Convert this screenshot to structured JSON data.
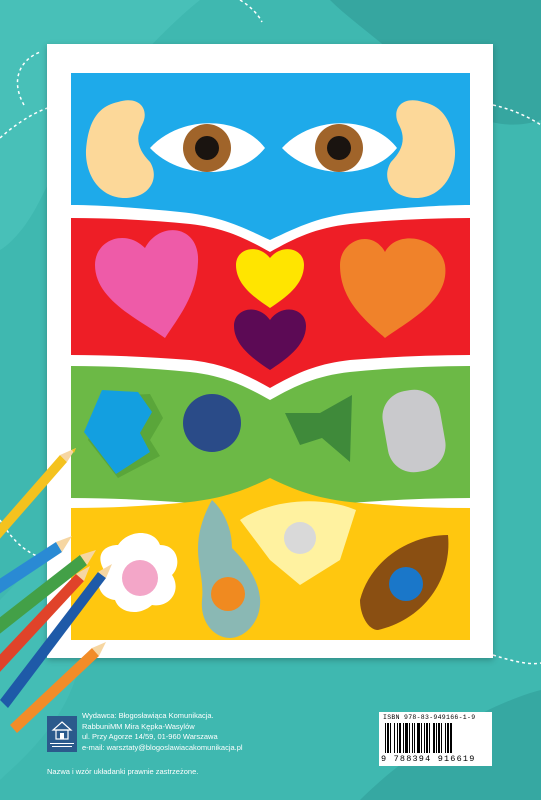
{
  "colors": {
    "background": "#3fb8b0",
    "band_blue": "#1eaaea",
    "band_red": "#ee1e26",
    "band_green": "#6cb946",
    "band_yellow": "#ffc70f"
  },
  "publisher": {
    "line1": "Wydawca: Błogosławiąca Komunikacja.",
    "line2": "RabbuniMM Mira Kępka-Wasylów",
    "line3": "ul. Przy Agorze 14/59, 01-960 Warszawa",
    "line4": "e-mail: warsztaty@blogoslawiacakomunikacja.pl"
  },
  "logo_text": "BŁOGOSŁAWIĄCA KOMUNIKACJA",
  "rights": "Nazwa i wzór układanki prawnie zastrzeżone.",
  "barcode": {
    "isbn": "ISBN 978-83-949166-1-9",
    "ean": "9 788394 916619"
  }
}
